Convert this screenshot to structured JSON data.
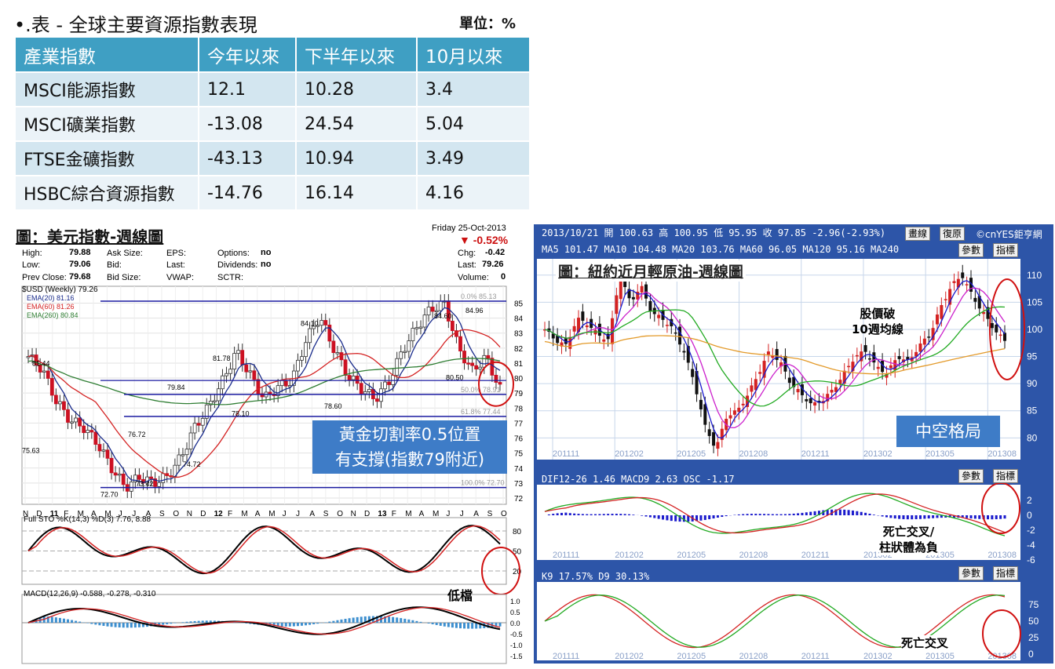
{
  "heading": "•.表 - 全球主要資源指數表現",
  "unit": "單位：%",
  "table": {
    "headers": [
      "產業指數",
      "今年以來",
      "下半年以來",
      "10月以來"
    ],
    "rows": [
      [
        "MSCI能源指數",
        "12.1",
        "10.28",
        "3.4"
      ],
      [
        "MSCI礦業指數",
        "-13.08",
        "24.54",
        "5.04"
      ],
      [
        "FTSE金礦指數",
        "-43.13",
        "10.94",
        "3.49"
      ],
      [
        "HSBC綜合資源指數",
        "-14.76",
        "16.14",
        "4.16"
      ]
    ]
  },
  "left_chart": {
    "title": "圖：美元指數-週線圖",
    "date_label": "Friday   25-Oct-2013",
    "change_pct": "▼ -0.52%",
    "quote": {
      "high_label": "High:",
      "high": "79.88",
      "low_label": "Low:",
      "low": "79.06",
      "prev_label": "Prev Close:",
      "prev": "79.68",
      "ask": "Ask Size:",
      "bid": "Bid:",
      "bidsize": "Bid Size:",
      "eps": "EPS:",
      "last": "Last:",
      "vwap": "VWAP:",
      "options_label": "Options:",
      "options": "no",
      "dividends_label": "Dividends:",
      "dividends": "no",
      "sctr": "SCTR:",
      "chg_label": "Chg:",
      "chg": "-0.42",
      "lastprice_label": "Last:",
      "lastprice": "79.26",
      "volume_label": "Volume:",
      "volume": "0"
    },
    "legend": [
      "$USD (Weekly) 79.26",
      "EMA(20) 81.16",
      "EMA(60) 81.26",
      "EMA(260) 80.84"
    ],
    "colors": {
      "ema20": "#1a2c8c",
      "ema60": "#d42222",
      "ema260": "#2e7d32",
      "fib": "#1a1aa0"
    },
    "annotation": "黃金切割率0.5位置\n有支撐(指數79附近)",
    "low_note": "低檔",
    "sto_label": "Full STO %K(14,3) %D(3) 7.76, 8.88",
    "macd_label": "MACD(12,26,9) -0.588, -0.278, -0.310"
  },
  "right_chart": {
    "header1": "2013/10/21 開 100.63 高 100.95 低 95.95 收 97.85 -2.96(-2.93%)",
    "header2": "MA5 101.47   MA10 104.48   MA20 103.76   MA60 96.05   MA120 95.16   MA240",
    "btn_draw": "畫線",
    "btn_restore": "復原",
    "brand": "©cnYES鉅亨網",
    "btn_param": "參數",
    "btn_indicator": "指標",
    "title": "圖：紐約近月輕原油-週線圖",
    "note_break": "股價破\n10週均線",
    "box": "中空格局",
    "macd_header": "DIF12-26 1.46   MACD9 2.63   OSC -1.17",
    "macd_note": "死亡交叉/\n柱狀體為負",
    "kd_header": "K9 17.57%   D9 30.13%",
    "kd_note": "死亡交叉"
  },
  "chart_data": [
    {
      "type": "line",
      "title": "圖：美元指數-週線圖",
      "series": [
        {
          "name": "$USD (Weekly) 79.26",
          "values": [
            81.44,
            80.6,
            78.5,
            77.2,
            76.7,
            75.63,
            74.0,
            72.7,
            73.4,
            73.0,
            73.42,
            74.72,
            76.72,
            78.1,
            79.8,
            81.78,
            80.2,
            78.6,
            79.4,
            79.84,
            82.5,
            84.1,
            82.0,
            80.2,
            79.3,
            78.6,
            79.8,
            81.9,
            83.4,
            84.6,
            84.96,
            82.0,
            80.5,
            81.4,
            79.26
          ]
        }
      ],
      "price_labels": [
        "81.44",
        "75.63",
        "72.70",
        "73.42",
        "74.72",
        "76.72",
        "78.10",
        "81.78",
        "79.84",
        "84.10",
        "78.60",
        "84.60",
        "84.96",
        "80.50"
      ],
      "fib_levels": [
        {
          "pct": "0.0%",
          "value": 85.13
        },
        {
          "pct": "50.0%",
          "value": 78.91
        },
        {
          "pct": "61.8%",
          "value": 77.44
        },
        {
          "pct": "100.0%",
          "value": 72.7
        }
      ],
      "y_ticks": [
        72,
        73,
        74,
        75,
        76,
        77,
        78,
        79,
        80,
        81,
        82,
        83,
        84,
        85
      ],
      "x_ticks": [
        "N",
        "D",
        "11",
        "F",
        "M",
        "A",
        "M",
        "J",
        "J",
        "A",
        "S",
        "O",
        "N",
        "D",
        "12",
        "F",
        "M",
        "A",
        "M",
        "J",
        "J",
        "A",
        "S",
        "O",
        "N",
        "D",
        "13",
        "F",
        "M",
        "A",
        "M",
        "J",
        "J",
        "A",
        "S",
        "O"
      ],
      "sto_ticks": [
        20,
        50,
        80
      ],
      "macd_ticks": [
        "1.0",
        "0.5",
        "0.0",
        "-0.5",
        "-1.0",
        "-1.5"
      ]
    },
    {
      "type": "line",
      "title": "圖：紐約近月輕原油-週線圖",
      "series": [
        {
          "name": "",
          "values": [
            100,
            98,
            97,
            102,
            101,
            99,
            98,
            110,
            105,
            108,
            103,
            102,
            100,
            96,
            90,
            82,
            78,
            84,
            85,
            88,
            92,
            96,
            94,
            90,
            88,
            86,
            87,
            89,
            92,
            95,
            96,
            93,
            92,
            95,
            94,
            97,
            99,
            104,
            108,
            110,
            106,
            103,
            100,
            97.85
          ]
        }
      ],
      "y_ticks": [
        80,
        85,
        90,
        95,
        100,
        105,
        110
      ],
      "x_ticks": [
        "201111",
        "201202",
        "201205",
        "201208",
        "201211",
        "201302",
        "201305",
        "201308"
      ],
      "macd_ticks": [
        2,
        0,
        -2,
        -4,
        -6
      ],
      "kd_ticks": [
        75,
        50,
        25,
        0
      ]
    }
  ]
}
